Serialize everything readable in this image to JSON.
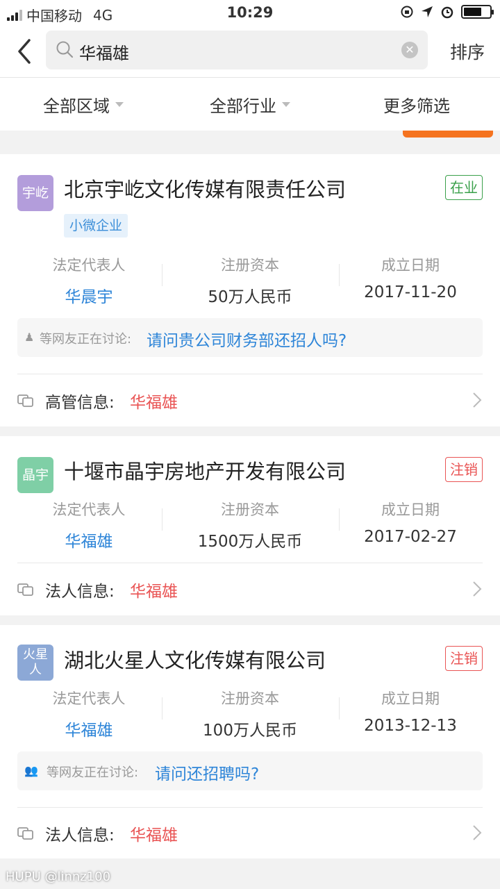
{
  "status_bar": {
    "carrier": "中国移动",
    "network": "4G",
    "time": "10:29",
    "battery_level": 0.7
  },
  "nav": {
    "search_query": "华福雄",
    "sort_label": "排序"
  },
  "filters": [
    "全部区域",
    "全部行业",
    "更多筛选"
  ],
  "companies": [
    {
      "logo_text": "宇屹",
      "logo_color": "#b39ddb",
      "name": "北京宇屹文化传媒有限责任公司",
      "status": "在业",
      "tag": "小微企业",
      "legal_rep_label": "法定代表人",
      "legal_rep": "华晨宇",
      "capital_label": "注册资本",
      "capital": "50万人民币",
      "date_label": "成立日期",
      "date": "2017-11-20",
      "discuss_prefix": "等网友正在讨论:",
      "discuss_question": "请问贵公司财务部还招人吗?",
      "match_label": "高管信息:",
      "match_name": "华福雄"
    },
    {
      "logo_text": "晶宇",
      "logo_color": "#7fcfa6",
      "name": "十堰市晶宇房地产开发有限公司",
      "status": "注销",
      "legal_rep_label": "法定代表人",
      "legal_rep": "华福雄",
      "capital_label": "注册资本",
      "capital": "1500万人民币",
      "date_label": "成立日期",
      "date": "2017-02-27",
      "match_label": "法人信息:",
      "match_name": "华福雄"
    },
    {
      "logo_text": "火星人",
      "logo_color": "#8ca8d6",
      "name": "湖北火星人文化传媒有限公司",
      "status": "注销",
      "legal_rep_label": "法定代表人",
      "legal_rep": "华福雄",
      "capital_label": "注册资本",
      "capital": "100万人民币",
      "date_label": "成立日期",
      "date": "2013-12-13",
      "discuss_prefix": "等网友正在讨论:",
      "discuss_question": "请问还招聘吗?",
      "match_label": "法人信息:",
      "match_name": "华福雄"
    }
  ],
  "watermark": "HUPU @linnz100"
}
